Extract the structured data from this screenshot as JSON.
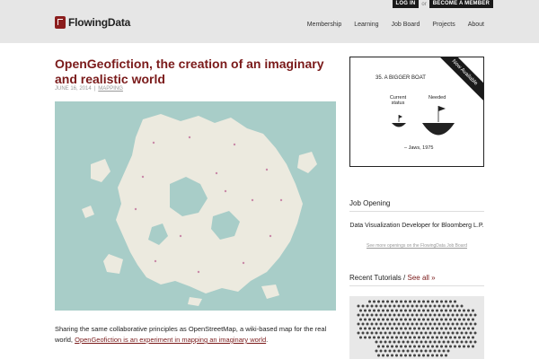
{
  "header": {
    "logo_text": "FlowingData",
    "login_label": "LOG IN",
    "or_text": "or",
    "become_member_label": "BECOME A MEMBER",
    "nav": [
      "Membership",
      "Learning",
      "Job Board",
      "Projects",
      "About"
    ]
  },
  "article": {
    "title": "OpenGeofiction, the creation of an imaginary and realistic world",
    "date": "JUNE 16, 2014",
    "separator": "|",
    "category": "MAPPING",
    "body_text": "Sharing the same collaborative principles as OpenStreetMap, a wiki-based map for the real world,",
    "body_link": "OpenGeofiction is an experiment in mapping an imaginary world",
    "body_end": "."
  },
  "ad": {
    "heading": "35.   A BIGGER BOAT",
    "label_current": "Current status",
    "label_needed": "Needed",
    "quote": "– Jaws, 1975",
    "ribbon": "Now Available"
  },
  "sidebar": {
    "job_section_title": "Job Opening",
    "job_title": "Data Visualization Developer for Bloomberg L.P.",
    "job_more": "See more openings on the FlowingData Job Board",
    "tutorials_title": "Recent Tutorials",
    "tutorials_separator": " / ",
    "see_all": "See all »"
  },
  "colors": {
    "accent": "#7a1a1a",
    "header_bg": "#e6e6e6",
    "map_water": "#a8cdc8",
    "map_land": "#eceadf"
  }
}
